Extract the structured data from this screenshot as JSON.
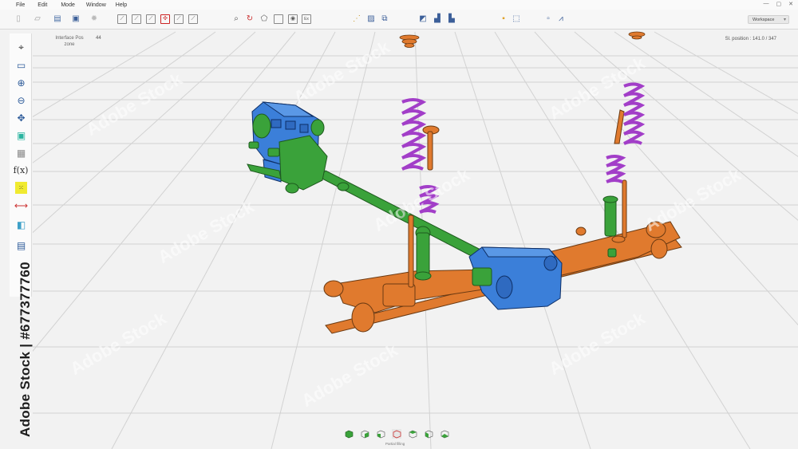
{
  "menu": [
    "File",
    "Edit",
    "Mode",
    "Window",
    "Help"
  ],
  "window_controls": [
    "—",
    "▢",
    "✕"
  ],
  "toolbar": {
    "workspace_label": "Workspace",
    "icons": [
      "new-icon",
      "open-icon",
      "print-icon",
      "save-icon",
      "settings-icon",
      "edit-icon",
      "edit-icon",
      "edit-icon",
      "snap-icon",
      "edit-icon",
      "edit-icon",
      "zoom-icon",
      "rotate-icon",
      "shape-icon",
      "box-icon",
      "center-icon",
      "fit-icon",
      "node-icon",
      "cube-icon",
      "cubes-icon",
      "align-icon",
      "stack-icon",
      "layer-icon",
      "select-icon",
      "move-icon",
      "link-icon",
      "measure-icon"
    ]
  },
  "left_panel": {
    "icons": [
      "crosshair-icon",
      "panel-icon",
      "zoom-in-icon",
      "zoom-out-icon",
      "move-arrows-icon",
      "cube-icon",
      "mesh-icon",
      "function-icon",
      "dots-icon",
      "ruler-icon",
      "layers-icon",
      "table-icon"
    ],
    "function_glyph": "f(x)"
  },
  "viewport": {
    "interface_label": "Interface Pos\nzone",
    "interface_value": "44",
    "position_label": "Sl. position : 141.0 / 347"
  },
  "bottom_bar": {
    "label": "Partial filling"
  },
  "watermark": {
    "vertical_text": "Adobe Stock | #677377760",
    "tile_text": "Adobe Stock"
  },
  "colors": {
    "engine": "#3b7fd9",
    "gearbox": "#3aa23a",
    "axle": "#e07a2e",
    "spring": "#a23ec8",
    "grid": "#cfcfcf",
    "background": "#f2f2f2"
  }
}
